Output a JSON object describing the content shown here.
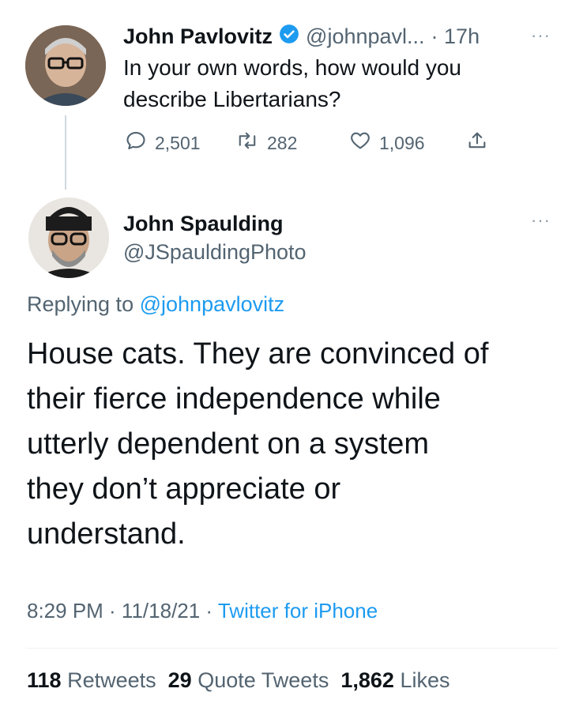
{
  "parent_tweet": {
    "author_name": "John Pavlovitz",
    "handle": "@johnpavl...",
    "time": "· 17h",
    "more": "···",
    "text_line1": "In your own words, how would you",
    "text_line2": "describe Libertarians?",
    "actions": {
      "replies": "2,501",
      "retweets": "282",
      "likes": "1,096"
    }
  },
  "reply_tweet": {
    "author_name": "John Spaulding",
    "handle": "@JSpauldingPhoto",
    "more": "···",
    "replying_prefix": "Replying to",
    "replying_handle": "@johnpavlovitz",
    "text_lines": [
      "House cats. They are convinced of",
      "their fierce independence while",
      "utterly dependent on a system",
      "they don’t appreciate or",
      "understand."
    ],
    "time": "8:29 PM · 11/18/21 ·",
    "source": "Twitter for iPhone",
    "stats": {
      "retweets_count": "118",
      "retweets_label": "Retweets",
      "quotes_count": "29",
      "quotes_label": "Quote Tweets",
      "likes_count": "1,862",
      "likes_label": "Likes"
    }
  },
  "colors": {
    "accent": "#1d9bf0",
    "secondary_text": "#536471",
    "primary_text": "#0f1419"
  }
}
